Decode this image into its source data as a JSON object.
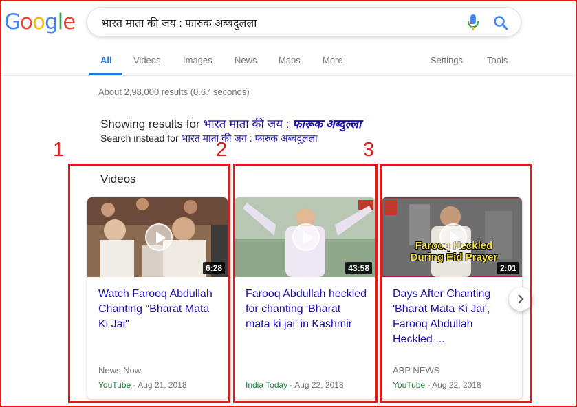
{
  "logo": "Google",
  "search": {
    "query": "भारत माता की जय : फारुक अब्बदुलला"
  },
  "tabs": [
    {
      "label": "All"
    },
    {
      "label": "Videos"
    },
    {
      "label": "Images"
    },
    {
      "label": "News"
    },
    {
      "label": "Maps"
    },
    {
      "label": "More"
    },
    {
      "label": "Settings"
    },
    {
      "label": "Tools"
    }
  ],
  "stats": "About 2,98,000 results (0.67 seconds)",
  "spelling": {
    "showing_prefix": "Showing results for",
    "showing_plain": "भारत माता की जय :",
    "showing_bold": "फारूक अब्दुल्ला",
    "instead_prefix": "Search instead for",
    "instead_query": "भारत माता की जय : फारुक अब्बदुलला"
  },
  "annotations": [
    "1",
    "2",
    "3"
  ],
  "videos": {
    "heading": "Videos",
    "items": [
      {
        "title": "Watch Farooq Abdullah Chanting \"Bharat Mata Ki Jai\"",
        "duration": "6:28",
        "source": "News Now",
        "site": "YouTube",
        "date": "Aug 21, 2018"
      },
      {
        "title": "Farooq Abdullah heckled for chanting 'Bharat mata ki jai' in Kashmir",
        "duration": "43:58",
        "source": "",
        "site": "India Today",
        "date": "Aug 22, 2018"
      },
      {
        "title": "Days After Chanting 'Bharat Mata Ki Jai', Farooq Abdullah Heckled ...",
        "duration": "2:01",
        "source": "ABP NEWS",
        "site": "YouTube",
        "date": "Aug 22, 2018",
        "thumb_caption": "Farooq Heckled During Eid Prayer"
      }
    ]
  },
  "colors": {
    "annotation_red": "#e01b1b",
    "link": "#1a0dab",
    "tab_active": "#1a73e8",
    "site_green": "#188038"
  }
}
